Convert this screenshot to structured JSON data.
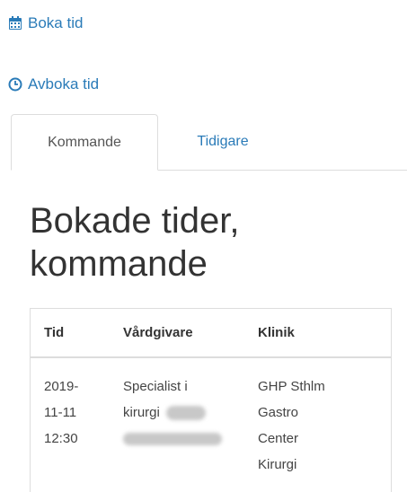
{
  "actions": {
    "book_label": "Boka tid",
    "book_icon": "calendar-icon",
    "cancel_label": "Avboka tid",
    "cancel_icon": "clock-icon"
  },
  "tabs": [
    {
      "label": "Kommande",
      "active": true
    },
    {
      "label": "Tidigare",
      "active": false
    }
  ],
  "heading": "Bokade tider, kommande",
  "table": {
    "headers": [
      "Tid",
      "Vårdgivare",
      "Klinik"
    ],
    "rows": [
      {
        "time_lines": [
          "2019-",
          "11-11",
          "12:30"
        ],
        "provider_line1": "Specialist i",
        "provider_line2": "kirurgi",
        "clinic_lines": [
          "GHP Sthlm",
          "Gastro",
          "Center",
          "Kirurgi"
        ]
      }
    ]
  },
  "colors": {
    "link": "#2a7bb8",
    "text": "#333333",
    "border": "#dddddd"
  }
}
